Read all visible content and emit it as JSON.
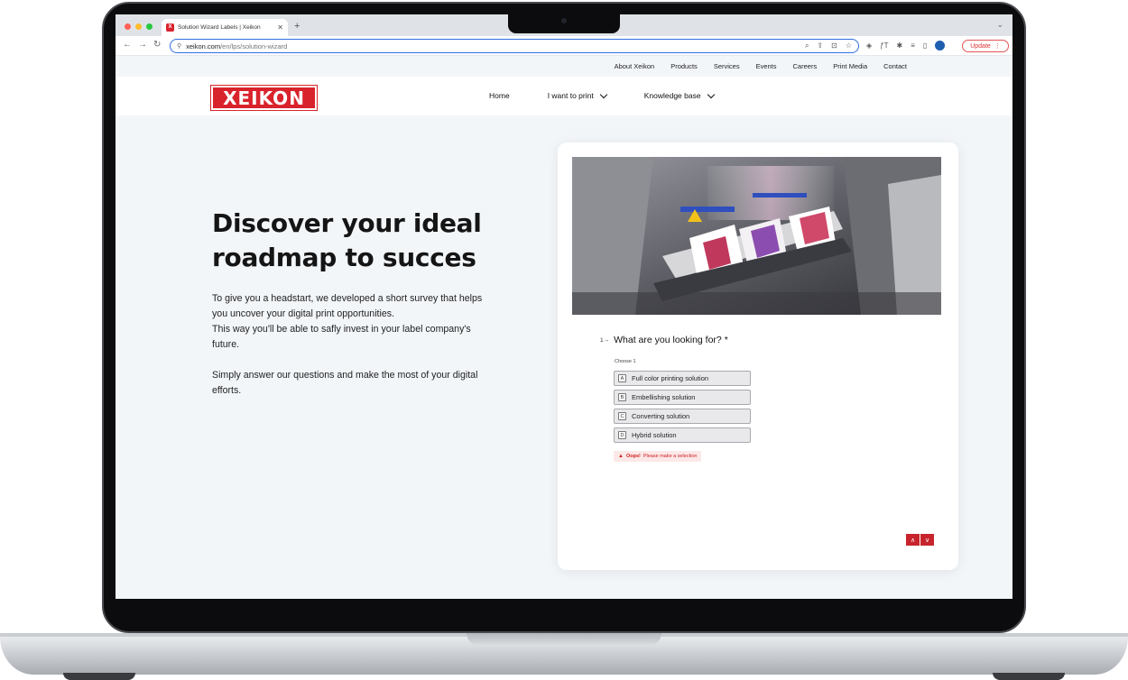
{
  "browser": {
    "tab_title": "Solution Wizard Labels | Xeikon",
    "tab_close": "✕",
    "new_tab": "+",
    "url_host": "xeikon.com",
    "url_path": "/en/lps/solution-wizard",
    "update_label": "Update"
  },
  "utility_nav": {
    "items": [
      "About Xeikon",
      "Products",
      "Services",
      "Events",
      "Careers",
      "Print Media",
      "Contact"
    ]
  },
  "header": {
    "logo_text": "XEIKON",
    "nav": {
      "home": "Home",
      "i_want_to_print": "I want to print",
      "knowledge_base": "Knowledge base"
    }
  },
  "hero": {
    "title": "Discover your ideal roadmap to succes",
    "para1": "To give you a headstart, we developed a short survey that helps you uncover your digital print opportunities.",
    "para2": "This way you'll be able to safly invest in your label company's future.",
    "para3": "Simply answer our questions and make the most of your digital efforts."
  },
  "survey": {
    "question_number": "1→",
    "question": "What are you looking for? *",
    "choose_hint": "Choose 1",
    "options": [
      {
        "key": "A",
        "label": "Full color printing solution"
      },
      {
        "key": "B",
        "label": "Embellishing solution"
      },
      {
        "key": "C",
        "label": "Converting solution"
      },
      {
        "key": "D",
        "label": "Hybrid solution"
      }
    ],
    "error_strong": "Oops!",
    "error_text": "Please make a selection",
    "prev_arrow": "∧",
    "next_arrow": "∨"
  },
  "colors": {
    "brand_red": "#d9232c",
    "accent_blue": "#2f6fe0",
    "page_bg": "#f3f6f9"
  }
}
